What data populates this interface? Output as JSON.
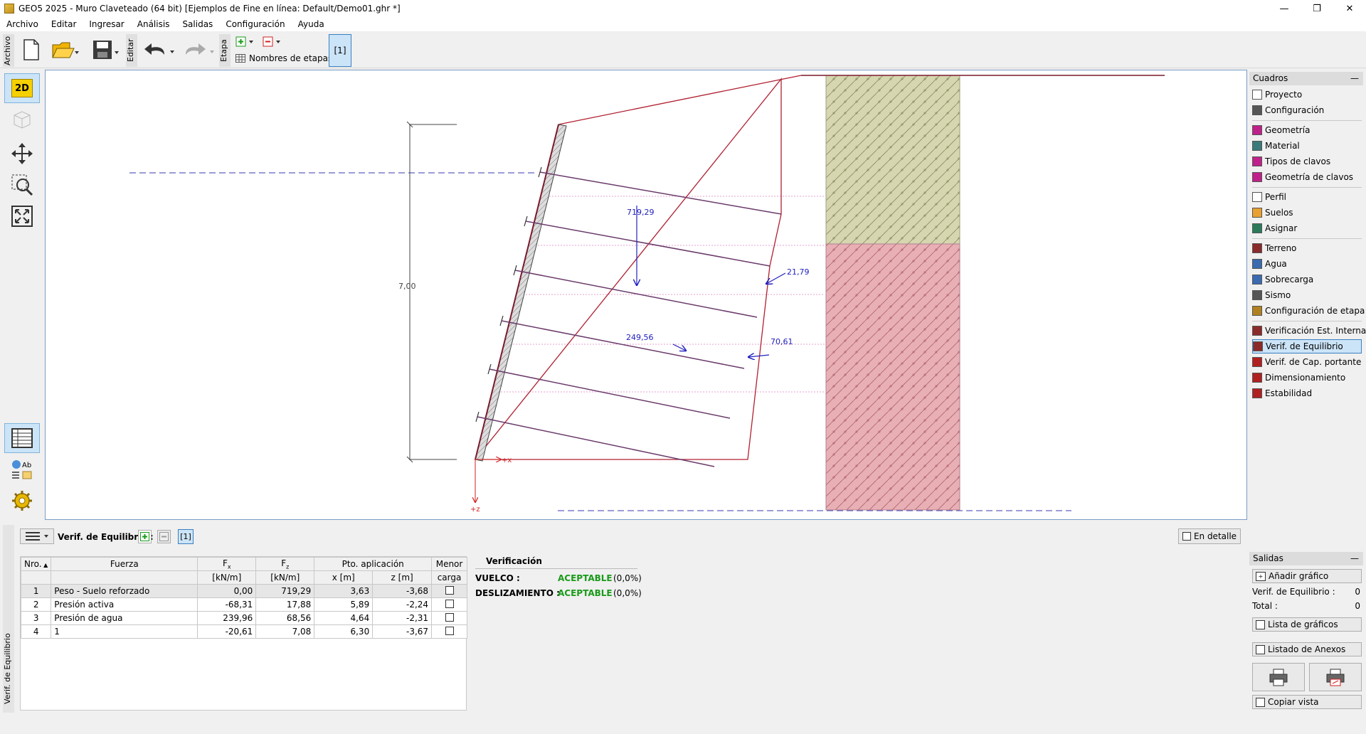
{
  "window": {
    "title": "GEO5 2025 - Muro Claveteado (64 bit) [Ejemplos de Fine en línea: Default/Demo01.ghr *]"
  },
  "menu": [
    "Archivo",
    "Editar",
    "Ingresar",
    "Análisis",
    "Salidas",
    "Configuración",
    "Ayuda"
  ],
  "toolbar": {
    "archivo_label": "Archivo",
    "editar_label": "Editar",
    "etapa_label": "Etapa",
    "nombres_etapas": "Nombres de etapas",
    "stage_button": "[1]"
  },
  "left_tools": {
    "btn_2d": "2D",
    "btn_3d": "3D"
  },
  "drawing": {
    "height_label": "7,00",
    "force_weight": "719,29",
    "force_active": "21,79",
    "force_water_left": "249,56",
    "force_water_right": "70,61",
    "axis_x": "+x",
    "axis_z": "+z"
  },
  "cuadros": {
    "header": "Cuadros",
    "groups": [
      [
        {
          "label": "Proyecto",
          "icon": "document-icon"
        },
        {
          "label": "Configuración",
          "icon": "gear-icon"
        }
      ],
      [
        {
          "label": "Geometría",
          "icon": "geometry-icon"
        },
        {
          "label": "Material",
          "icon": "material-icon"
        },
        {
          "label": "Tipos de clavos",
          "icon": "nail-types-icon"
        },
        {
          "label": "Geometría de clavos",
          "icon": "nail-geometry-icon"
        }
      ],
      [
        {
          "label": "Perfil",
          "icon": "profile-icon"
        },
        {
          "label": "Suelos",
          "icon": "soils-icon"
        },
        {
          "label": "Asignar",
          "icon": "assign-icon"
        }
      ],
      [
        {
          "label": "Terreno",
          "icon": "terrain-icon"
        },
        {
          "label": "Agua",
          "icon": "water-icon"
        },
        {
          "label": "Sobrecarga",
          "icon": "surcharge-icon"
        },
        {
          "label": "Sismo",
          "icon": "earthquake-icon"
        },
        {
          "label": "Configuración de etapa",
          "icon": "stage-settings-icon"
        }
      ],
      [
        {
          "label": "Verificación Est. Interna",
          "icon": "internal-check-icon"
        },
        {
          "label": "Verif. de Equilibrio",
          "icon": "equilibrium-icon",
          "selected": true
        },
        {
          "label": "Verif. de Cap. portante",
          "icon": "bearing-icon"
        },
        {
          "label": "Dimensionamiento",
          "icon": "dimensioning-icon"
        },
        {
          "label": "Estabilidad",
          "icon": "stability-icon"
        }
      ]
    ]
  },
  "salidas": {
    "header": "Salidas",
    "add_graphic": "Añadir gráfico",
    "verif_label": "Verif. de Equilibrio :",
    "verif_count": "0",
    "total_label": "Total :",
    "total_count": "0",
    "graphics_list": "Lista de gráficos",
    "annex_list": "Listado de Anexos",
    "copy_view": "Copiar vista"
  },
  "bottom": {
    "side_tab": "Verif. de Equilibrio",
    "panel_title": "Verif. de Equilibrio :",
    "stage_tag": "[1]",
    "detail_button": "En detalle",
    "columns": {
      "nro": "Nro.",
      "fuerza": "Fuerza",
      "fx": "F",
      "fx_sub": "x",
      "fz": "F",
      "fz_sub": "z",
      "pto": "Pto. aplicación",
      "menor": "Menor",
      "units_f": "[kN/m]",
      "x": "x [m]",
      "z": "z [m]",
      "carga": "carga"
    },
    "rows": [
      {
        "nro": "1",
        "fuerza": "Peso - Suelo reforzado",
        "fx": "0,00",
        "fz": "719,29",
        "x": "3,63",
        "z": "-3,68"
      },
      {
        "nro": "2",
        "fuerza": "Presión activa",
        "fx": "-68,31",
        "fz": "17,88",
        "x": "5,89",
        "z": "-2,24"
      },
      {
        "nro": "3",
        "fuerza": "Presión de agua",
        "fx": "239,96",
        "fz": "68,56",
        "x": "4,64",
        "z": "-2,31"
      },
      {
        "nro": "4",
        "fuerza": "1",
        "fx": "-20,61",
        "fz": "7,08",
        "x": "6,30",
        "z": "-3,67"
      }
    ],
    "verification": {
      "title": "Verificación",
      "vuelco_label": "VUELCO :",
      "vuelco_status": "ACEPTABLE",
      "vuelco_value": "(0,0%)",
      "desliz_label": "DESLIZAMIENTO :",
      "desliz_status": "ACEPTABLE",
      "desliz_value": "(0,0%)"
    }
  }
}
